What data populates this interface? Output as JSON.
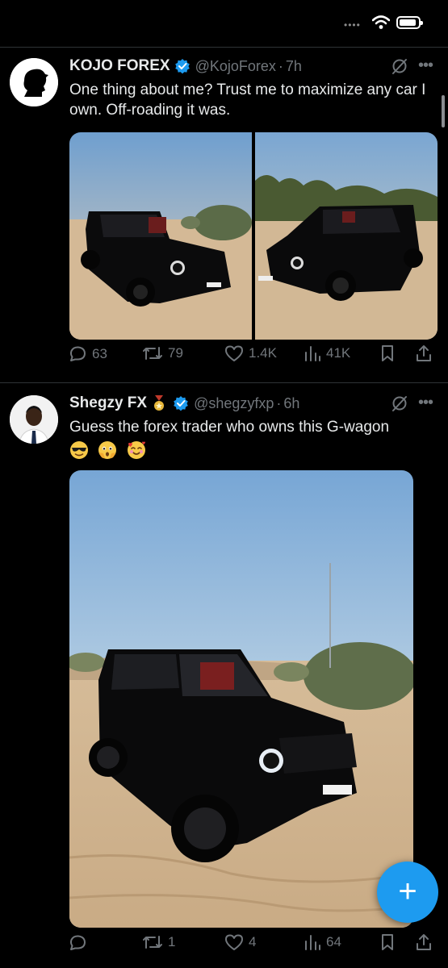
{
  "status_bar": {
    "signal_icon": "signal-dots-icon",
    "wifi_icon": "wifi-icon",
    "battery_icon": "battery-icon"
  },
  "tweets": [
    {
      "display_name": "KOJO FOREX",
      "handle": "@KojoForex",
      "separator": "·",
      "time": "7h",
      "text": "One thing about me? Trust me to maximize any car I own. Off-roading it was.",
      "images": [
        "black-g-wagon-front-left-desert",
        "black-g-wagon-front-right-desert"
      ],
      "stats": {
        "replies": "63",
        "reposts": "79",
        "likes": "1.4K",
        "views": "41K"
      }
    },
    {
      "display_name": "Shegzy FX",
      "handle": "@shegzyfxp",
      "separator": "·",
      "time": "6h",
      "text": "Guess the forex trader who owns this G-wagon",
      "emojis": [
        "sunglasses-face",
        "face-holding-back-tears",
        "smiling-face-with-hearts"
      ],
      "images": [
        "black-g-wagon-desert-portrait"
      ],
      "stats": {
        "replies": "",
        "reposts": "1",
        "likes": "4",
        "views": "64"
      }
    }
  ],
  "fab": {
    "label": "+"
  },
  "colors": {
    "background": "#000000",
    "text": "#e7e9ea",
    "secondary": "#71767b",
    "accent": "#1d9bf0",
    "divider": "#2f3336"
  }
}
